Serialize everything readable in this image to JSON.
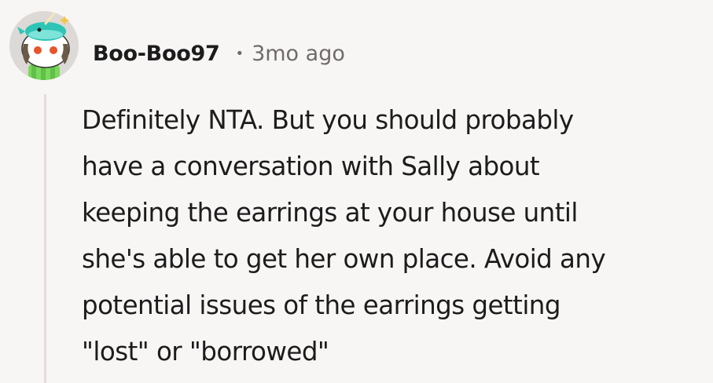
{
  "comment": {
    "author": "Boo-Boo97",
    "separator": "•",
    "timestamp": "3mo ago",
    "body": "Definitely NTA. But you should probably\nhave a conversation with Sally about\nkeeping the earrings at your house until\nshe's able to get her own place. Avoid any\npotential issues of the earrings getting\n\"lost\" or \"borrowed\""
  },
  "avatar": {
    "icon": "snoo-avatar-icon",
    "colors": {
      "circle": "#dcd9d6",
      "hat": "#2ec4b6",
      "shirt": "#7bd85a",
      "hair": "#6b5a45"
    }
  },
  "colors": {
    "background": "#f8f6f5",
    "text": "#1c1c1c",
    "meta": "#6f6b69",
    "thread_line": "#e4dedb"
  }
}
